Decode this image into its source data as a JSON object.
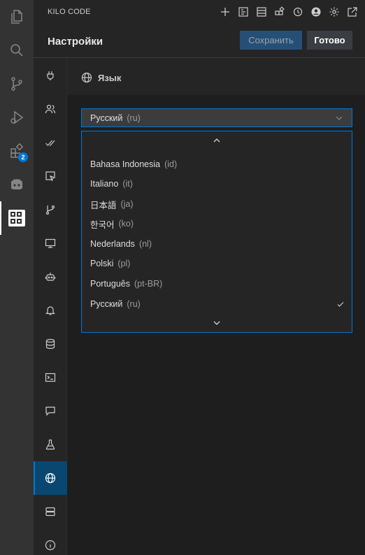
{
  "activity_bar": {
    "items": [
      {
        "icon": "files-icon"
      },
      {
        "icon": "search-icon"
      },
      {
        "icon": "source-control-icon"
      },
      {
        "icon": "run-debug-icon"
      },
      {
        "icon": "extensions-icon",
        "badge": "2"
      },
      {
        "icon": "godot-icon"
      },
      {
        "icon": "kilo-code-icon",
        "active": true
      }
    ]
  },
  "panel": {
    "title": "KILO CODE",
    "header_icons": [
      "plus-icon",
      "prompts-icon",
      "history-list-icon",
      "marketplace-icon",
      "history-icon",
      "account-icon",
      "gear-icon",
      "popout-icon"
    ]
  },
  "settings": {
    "title": "Настройки",
    "save_label": "Сохранить",
    "done_label": "Готово"
  },
  "tabs": [
    {
      "icon": "plug-icon"
    },
    {
      "icon": "users-icon"
    },
    {
      "icon": "check-all-icon"
    },
    {
      "icon": "browser-pointer-icon"
    },
    {
      "icon": "git-branch-icon"
    },
    {
      "icon": "monitor-icon"
    },
    {
      "icon": "robot-icon"
    },
    {
      "icon": "bell-icon"
    },
    {
      "icon": "database-icon"
    },
    {
      "icon": "terminal-icon"
    },
    {
      "icon": "chat-icon"
    },
    {
      "icon": "flask-icon"
    },
    {
      "icon": "globe-icon",
      "active": true
    },
    {
      "icon": "server-icon"
    },
    {
      "icon": "info-icon"
    }
  ],
  "language_section": {
    "title": "Язык",
    "selected": {
      "name": "Русский",
      "code": "(ru)"
    },
    "options": [
      {
        "name": "Bahasa Indonesia",
        "code": "(id)"
      },
      {
        "name": "Italiano",
        "code": "(it)"
      },
      {
        "name": "日本語",
        "code": "(ja)"
      },
      {
        "name": "한국어",
        "code": "(ko)"
      },
      {
        "name": "Nederlands",
        "code": "(nl)"
      },
      {
        "name": "Polski",
        "code": "(pl)"
      },
      {
        "name": "Português",
        "code": "(pt-BR)"
      },
      {
        "name": "Русский",
        "code": "(ru)",
        "checked": true
      }
    ]
  }
}
